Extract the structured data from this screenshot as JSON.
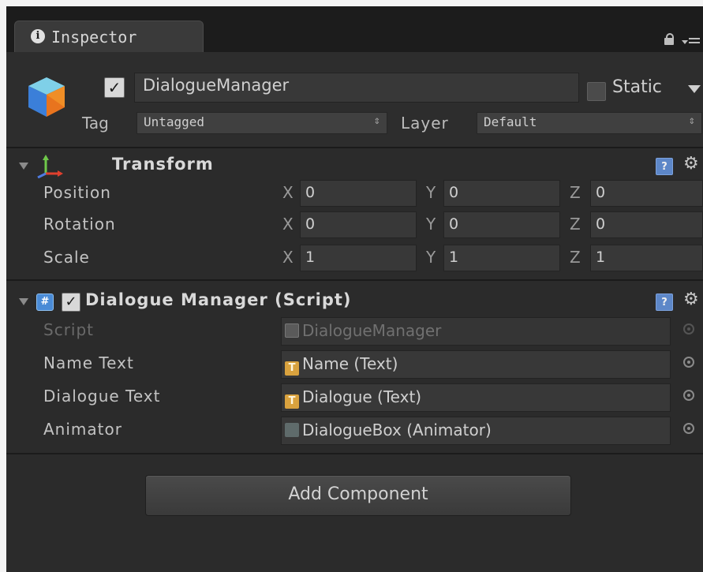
{
  "tab": {
    "label": "Inspector",
    "icon": "info-icon"
  },
  "object": {
    "name": "DialogueManager",
    "active": true,
    "static_label": "Static",
    "tag_label": "Tag",
    "tag_value": "Untagged",
    "layer_label": "Layer",
    "layer_value": "Default"
  },
  "transform": {
    "title": "Transform",
    "rows": [
      {
        "label": "Position",
        "x": "0",
        "y": "0",
        "z": "0"
      },
      {
        "label": "Rotation",
        "x": "0",
        "y": "0",
        "z": "0"
      },
      {
        "label": "Scale",
        "x": "1",
        "y": "1",
        "z": "1"
      }
    ],
    "axes": [
      "X",
      "Y",
      "Z"
    ]
  },
  "script_component": {
    "title": "Dialogue Manager (Script)",
    "enabled": true,
    "fields": [
      {
        "label": "Script",
        "value": "DialogueManager",
        "icon": "script-icon"
      },
      {
        "label": "Name Text",
        "value": "Name (Text)",
        "icon": "text-icon"
      },
      {
        "label": "Dialogue Text",
        "value": "Dialogue (Text)",
        "icon": "text-icon"
      },
      {
        "label": "Animator",
        "value": "DialogueBox (Animator)",
        "icon": "animator-icon"
      }
    ]
  },
  "add_component_label": "Add Component",
  "colors": {
    "panel": "#2b2b2b",
    "tabbar": "#1c1c1c",
    "field": "#383838",
    "text_icon": "#d9a23e",
    "help_icon": "#5d87c8"
  }
}
